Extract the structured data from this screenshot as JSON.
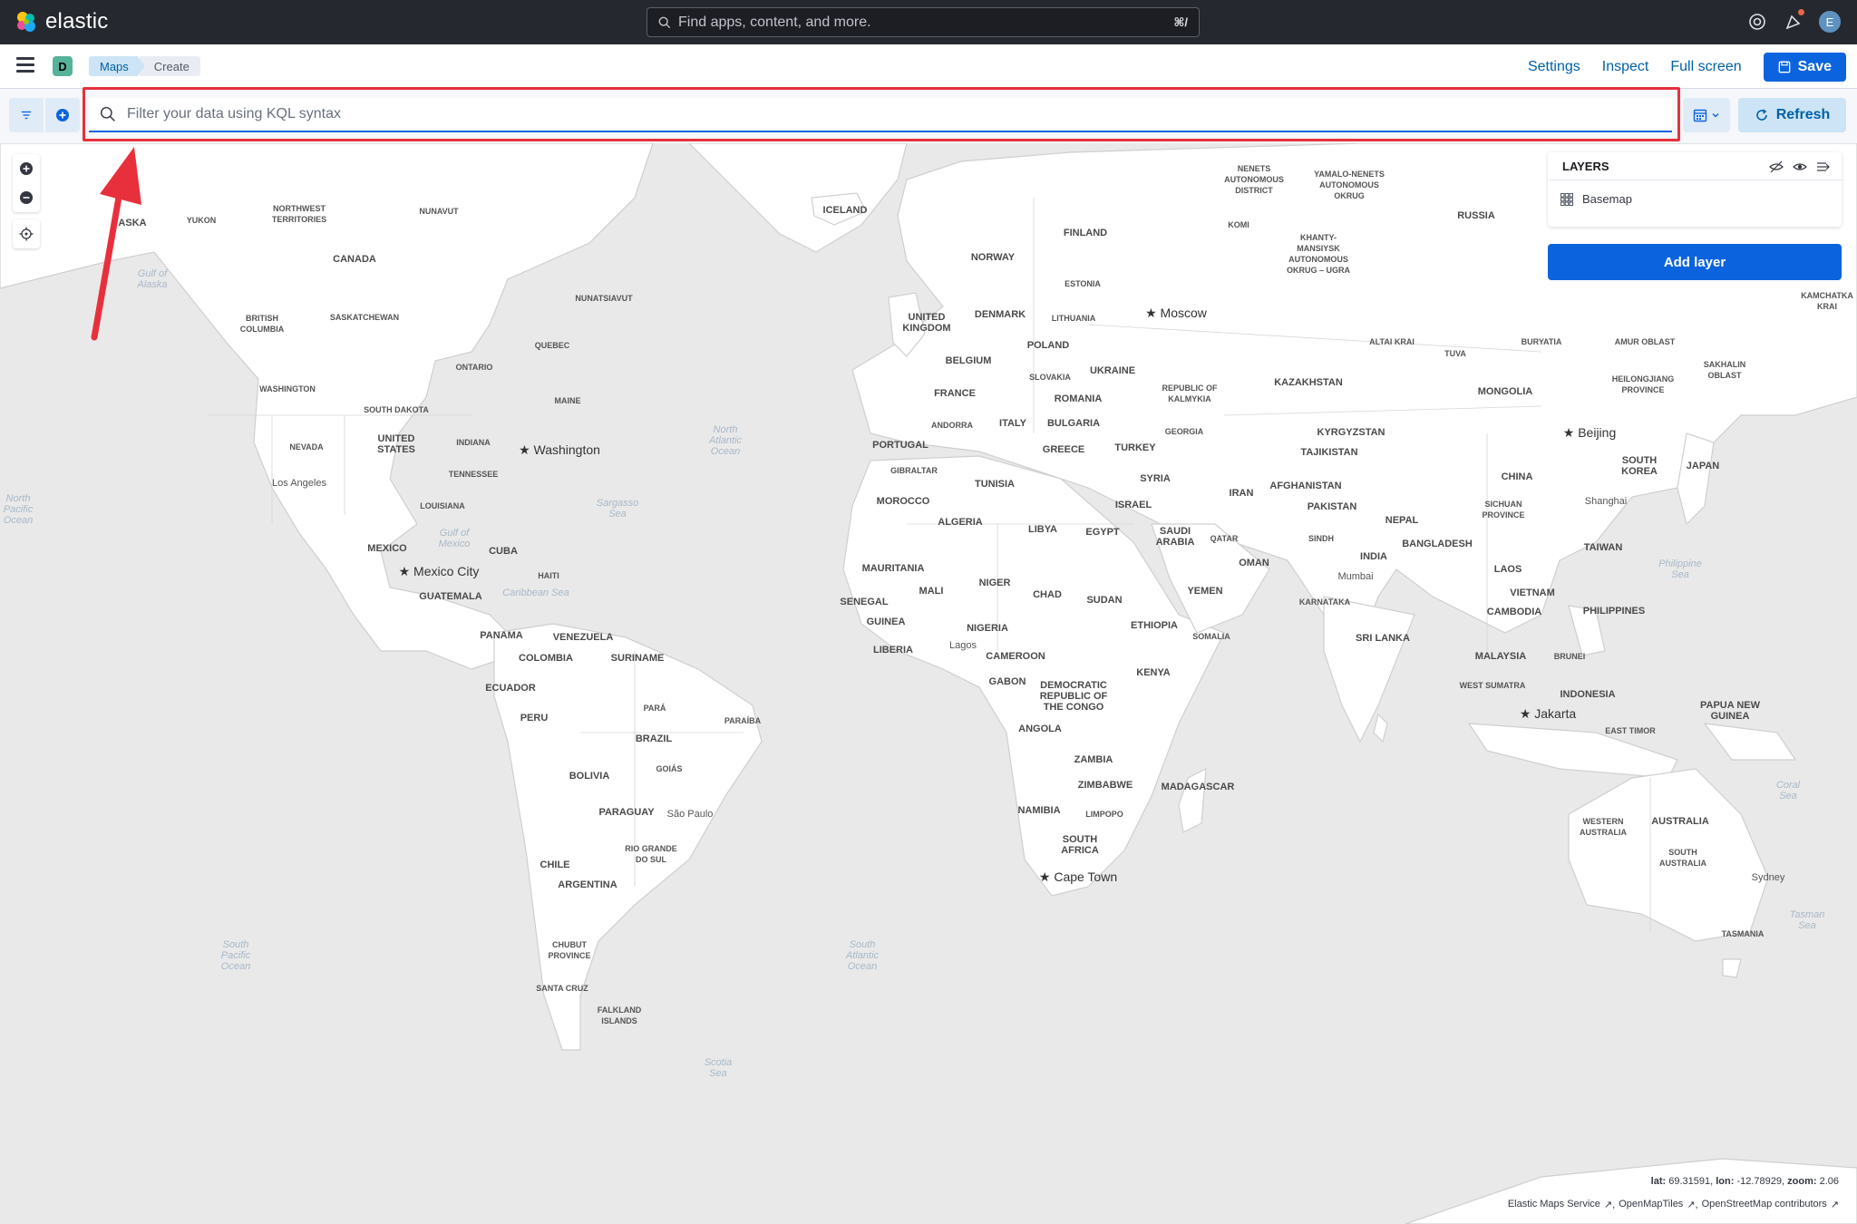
{
  "header": {
    "brand": "elastic",
    "search_placeholder": "Find apps, content, and more.",
    "search_shortcut": "⌘/",
    "avatar_initial": "E"
  },
  "app_bar": {
    "space_initial": "D",
    "breadcrumbs": [
      "Maps",
      "Create"
    ],
    "links": [
      "Settings",
      "Inspect",
      "Full screen"
    ],
    "save_label": "Save"
  },
  "query_bar": {
    "kql_placeholder": "Filter your data using KQL syntax",
    "kql_value": "",
    "refresh_label": "Refresh"
  },
  "map": {
    "zoom_in": "+",
    "zoom_out": "−",
    "layers_title": "LAYERS",
    "layers": [
      {
        "name": "Basemap",
        "icon": "grid-icon"
      }
    ],
    "add_layer_label": "Add layer",
    "coords": {
      "lat_label": "lat:",
      "lat": "69.31591",
      "lon_label": "lon:",
      "lon": "-12.78929",
      "zoom_label": "zoom:",
      "zoom": "2.06"
    },
    "attribution": [
      "Elastic Maps Service",
      "OpenMapTiles",
      "OpenStreetMap contributors"
    ],
    "labels": {
      "countries": [
        "ASKA",
        "YUKON",
        "NORTHWEST TERRITORIES",
        "NUNAVUT",
        "CANADA",
        "BRITISH COLUMBIA",
        "SASKATCHEWAN",
        "NUNATSIAVUT",
        "QUEBEC",
        "ONTARIO",
        "WASHINGTON",
        "SOUTH DAKOTA",
        "MAINE",
        "NEVADA",
        "UNITED STATES",
        "INDIANA",
        "TENNESSEE",
        "LOUISIANA",
        "MEXICO",
        "CUBA",
        "HAITI",
        "GUATEMALA",
        "PANAMA",
        "VENEZUELA",
        "COLOMBIA",
        "SURINAME",
        "ECUADOR",
        "PERU",
        "PARÁ",
        "PARAÍBA",
        "BRAZIL",
        "GOIÁS",
        "BOLIVIA",
        "PARAGUAY",
        "RIO GRANDE DO SUL",
        "CHILE",
        "ARGENTINA",
        "CHUBUT PROVINCE",
        "SANTA CRUZ",
        "FALKLAND ISLANDS",
        "ICELAND",
        "FINLAND",
        "NORWAY",
        "ESTONIA",
        "UNITED KINGDOM",
        "DENMARK",
        "LITHUANIA",
        "POLAND",
        "BELGIUM",
        "FRANCE",
        "SLOVAKIA",
        "UKRAINE",
        "ROMANIA",
        "ANDORRA",
        "ITALY",
        "BULGARIA",
        "PORTUGAL",
        "GREECE",
        "TURKEY",
        "GIBRALTAR",
        "TUNISIA",
        "MOROCCO",
        "ALGERIA",
        "LIBYA",
        "EGYPT",
        "MAURITANIA",
        "MALI",
        "NIGER",
        "CHAD",
        "SUDAN",
        "SENEGAL",
        "GUINEA",
        "NIGERIA",
        "ETHIOPIA",
        "SOMALIA",
        "LIBERIA",
        "CAMEROON",
        "GABON",
        "DEMOCRATIC REPUBLIC OF THE CONGO",
        "KENYA",
        "ANGOLA",
        "ZAMBIA",
        "ZIMBABWE",
        "MADAGASCAR",
        "NAMIBIA",
        "LIMPOPO",
        "SOUTH AFRICA",
        "NENETS AUTONOMOUS DISTRICT",
        "YAMALO-NENETS AUTONOMOUS OKRUG",
        "KOMI",
        "KHANTY-MANSIYSK AUTONOMOUS OKRUG – UGRA",
        "RUSSIA",
        "REPUBLIC OF KALMYKIA",
        "GEORGIA",
        "KAZAKHSTAN",
        "ALTAI KRAI",
        "TUVA",
        "BURYATIA",
        "AMUR OBLAST",
        "SAKHALIN OBLAST",
        "HEILONGJIANG PROVINCE",
        "MONGOLIA",
        "KYRGYZSTAN",
        "TAJIKISTAN",
        "SYRIA",
        "AFGHANISTAN",
        "ISRAEL",
        "IRAN",
        "PAKISTAN",
        "SAUDI ARABIA",
        "QATAR",
        "OMAN",
        "YEMEN",
        "CHINA",
        "SOUTH KOREA",
        "JAPAN",
        "SICHUAN PROVINCE",
        "NEPAL",
        "BANGLADESH",
        "SINDH",
        "INDIA",
        "TAIWAN",
        "LAOS",
        "VIETNAM",
        "PHILIPPINES",
        "CAMBODIA",
        "KARNATAKA",
        "SRI LANKA",
        "MALAYSIA",
        "BRUNEI",
        "WEST SUMATRA",
        "INDONESIA",
        "PAPUA NEW GUINEA",
        "EAST TIMOR",
        "WESTERN AUSTRALIA",
        "AUSTRALIA",
        "SOUTH AUSTRALIA",
        "TASMANIA",
        "KAMCHATKA KRAI"
      ],
      "cities": [
        "Moscow",
        "Washington",
        "Los Angeles",
        "Mexico City",
        "Beijing",
        "Shanghai",
        "Mumbai",
        "Lagos",
        "São Paulo",
        "Cape Town",
        "Jakarta",
        "Sydney"
      ],
      "oceans": [
        "Gulf of Alaska",
        "North Atlantic Ocean",
        "Sargasso Sea",
        "Gulf of Mexico",
        "Caribbean Sea",
        "North Pacific Ocean",
        "South Pacific Ocean",
        "South Atlantic Ocean",
        "Scotia Sea",
        "Philippine Sea",
        "Coral Sea",
        "Tasman Sea"
      ]
    }
  },
  "colors": {
    "header_bg": "#25282f",
    "primary": "#0b64dd",
    "link": "#0061a6",
    "highlight": "#e8303d",
    "land": "#ffffff",
    "water": "#e9e9e9"
  }
}
